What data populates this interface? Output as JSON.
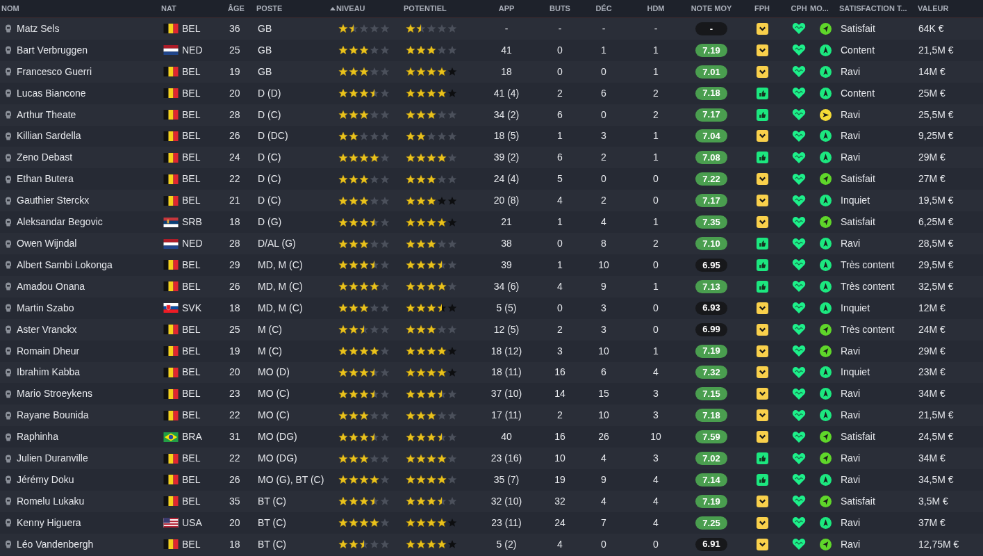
{
  "columns": [
    "NOM",
    "NAT",
    "ÂGE",
    "POSTE",
    "NIVEAU",
    "POTENTIEL",
    "APP",
    "BUTS",
    "DÉC",
    "HDM",
    "NOTE MOY",
    "FPH",
    "CPH",
    "MO...",
    "SATISFACTION T...",
    "VALEUR"
  ],
  "sorted_column": {
    "kind": "ascending"
  },
  "rows": [
    {
      "name": "Matz Sels",
      "nat": "BEL",
      "flag": {
        "kind": "be"
      },
      "age": "36",
      "poste": "GB",
      "niveau": {
        "stars": 1.5
      },
      "potentiel": {
        "stars": 1.5,
        "uncertain": false
      },
      "app": "-",
      "buts": "-",
      "dec": "-",
      "hdm": "-",
      "note": {
        "text": "-",
        "kind": "plain"
      },
      "fph": {
        "kind": "chevron"
      },
      "mo": {
        "kind": "diag"
      },
      "satisfaction": "Satisfait",
      "valeur": "64K €"
    },
    {
      "name": "Bart Verbruggen",
      "nat": "NED",
      "flag": {
        "kind": "nl"
      },
      "age": "25",
      "poste": "GB",
      "niveau": {
        "stars": 3
      },
      "potentiel": {
        "stars": 3,
        "uncertain": false
      },
      "app": "41",
      "buts": "0",
      "dec": "1",
      "hdm": "1",
      "note": {
        "text": "7.19",
        "kind": "good"
      },
      "fph": {
        "kind": "chevron"
      },
      "mo": {
        "kind": "up"
      },
      "satisfaction": "Content",
      "valeur": "21,5M €"
    },
    {
      "name": "Francesco Guerri",
      "nat": "BEL",
      "flag": {
        "kind": "be"
      },
      "age": "19",
      "poste": "GB",
      "niveau": {
        "stars": 3
      },
      "potentiel": {
        "stars": 4,
        "uncertain": true
      },
      "app": "18",
      "buts": "0",
      "dec": "0",
      "hdm": "1",
      "note": {
        "text": "7.01",
        "kind": "good"
      },
      "fph": {
        "kind": "chevron"
      },
      "mo": {
        "kind": "up"
      },
      "satisfaction": "Ravi",
      "valeur": "14M €"
    },
    {
      "name": "Lucas Biancone",
      "nat": "BEL",
      "flag": {
        "kind": "be"
      },
      "age": "20",
      "poste": "D (D)",
      "niveau": {
        "stars": 3.5
      },
      "potentiel": {
        "stars": 4,
        "uncertain": true
      },
      "app": "41 (4)",
      "buts": "2",
      "dec": "6",
      "hdm": "2",
      "note": {
        "text": "7.18",
        "kind": "good"
      },
      "fph": {
        "kind": "thumb"
      },
      "mo": {
        "kind": "up"
      },
      "satisfaction": "Content",
      "valeur": "25M €"
    },
    {
      "name": "Arthur Theate",
      "nat": "BEL",
      "flag": {
        "kind": "be"
      },
      "age": "28",
      "poste": "D (C)",
      "niveau": {
        "stars": 3
      },
      "potentiel": {
        "stars": 3,
        "uncertain": false
      },
      "app": "34 (2)",
      "buts": "6",
      "dec": "0",
      "hdm": "2",
      "note": {
        "text": "7.17",
        "kind": "good"
      },
      "fph": {
        "kind": "thumb"
      },
      "mo": {
        "kind": "right"
      },
      "satisfaction": "Ravi",
      "valeur": "25,5M €"
    },
    {
      "name": "Killian Sardella",
      "nat": "BEL",
      "flag": {
        "kind": "be"
      },
      "age": "26",
      "poste": "D (DC)",
      "niveau": {
        "stars": 2
      },
      "potentiel": {
        "stars": 2,
        "uncertain": false
      },
      "app": "18 (5)",
      "buts": "1",
      "dec": "3",
      "hdm": "1",
      "note": {
        "text": "7.04",
        "kind": "good"
      },
      "fph": {
        "kind": "chevron"
      },
      "mo": {
        "kind": "up"
      },
      "satisfaction": "Ravi",
      "valeur": "9,25M €"
    },
    {
      "name": "Zeno Debast",
      "nat": "BEL",
      "flag": {
        "kind": "be"
      },
      "age": "24",
      "poste": "D (C)",
      "niveau": {
        "stars": 4
      },
      "potentiel": {
        "stars": 4,
        "uncertain": false
      },
      "app": "39 (2)",
      "buts": "6",
      "dec": "2",
      "hdm": "1",
      "note": {
        "text": "7.08",
        "kind": "good"
      },
      "fph": {
        "kind": "thumb"
      },
      "mo": {
        "kind": "up"
      },
      "satisfaction": "Ravi",
      "valeur": "29M €"
    },
    {
      "name": "Ethan Butera",
      "nat": "BEL",
      "flag": {
        "kind": "be"
      },
      "age": "22",
      "poste": "D (C)",
      "niveau": {
        "stars": 3
      },
      "potentiel": {
        "stars": 3,
        "uncertain": false
      },
      "app": "24 (4)",
      "buts": "5",
      "dec": "0",
      "hdm": "0",
      "note": {
        "text": "7.22",
        "kind": "good"
      },
      "fph": {
        "kind": "chevron"
      },
      "mo": {
        "kind": "diag"
      },
      "satisfaction": "Satisfait",
      "valeur": "27M €"
    },
    {
      "name": "Gauthier Sterckx",
      "nat": "BEL",
      "flag": {
        "kind": "be"
      },
      "age": "21",
      "poste": "D (C)",
      "niveau": {
        "stars": 3
      },
      "potentiel": {
        "stars": 3,
        "uncertain": true
      },
      "app": "20 (8)",
      "buts": "4",
      "dec": "2",
      "hdm": "0",
      "note": {
        "text": "7.17",
        "kind": "good"
      },
      "fph": {
        "kind": "chevron"
      },
      "mo": {
        "kind": "up"
      },
      "satisfaction": "Inquiet",
      "valeur": "19,5M €"
    },
    {
      "name": "Aleksandar Begovic",
      "nat": "SRB",
      "flag": {
        "kind": "rs"
      },
      "age": "18",
      "poste": "D (G)",
      "niveau": {
        "stars": 3.5
      },
      "potentiel": {
        "stars": 4,
        "uncertain": true
      },
      "app": "21",
      "buts": "1",
      "dec": "4",
      "hdm": "1",
      "note": {
        "text": "7.35",
        "kind": "good"
      },
      "fph": {
        "kind": "chevron"
      },
      "mo": {
        "kind": "diag"
      },
      "satisfaction": "Satisfait",
      "valeur": "6,25M €"
    },
    {
      "name": "Owen Wijndal",
      "nat": "NED",
      "flag": {
        "kind": "nl"
      },
      "age": "28",
      "poste": "D/AL (G)",
      "niveau": {
        "stars": 3
      },
      "potentiel": {
        "stars": 3,
        "uncertain": false
      },
      "app": "38",
      "buts": "0",
      "dec": "8",
      "hdm": "2",
      "note": {
        "text": "7.10",
        "kind": "good"
      },
      "fph": {
        "kind": "thumb"
      },
      "mo": {
        "kind": "up"
      },
      "satisfaction": "Ravi",
      "valeur": "28,5M €"
    },
    {
      "name": "Albert Sambi Lokonga",
      "nat": "BEL",
      "flag": {
        "kind": "be"
      },
      "age": "29",
      "poste": "MD, M (C)",
      "niveau": {
        "stars": 3.5
      },
      "potentiel": {
        "stars": 3.5,
        "uncertain": false
      },
      "app": "39",
      "buts": "1",
      "dec": "10",
      "hdm": "0",
      "note": {
        "text": "6.95",
        "kind": "plain"
      },
      "fph": {
        "kind": "thumb"
      },
      "mo": {
        "kind": "up"
      },
      "satisfaction": "Très content",
      "valeur": "29,5M €"
    },
    {
      "name": "Amadou Onana",
      "nat": "BEL",
      "flag": {
        "kind": "be"
      },
      "age": "26",
      "poste": "MD, M (C)",
      "niveau": {
        "stars": 4
      },
      "potentiel": {
        "stars": 4,
        "uncertain": false
      },
      "app": "34 (6)",
      "buts": "4",
      "dec": "9",
      "hdm": "1",
      "note": {
        "text": "7.13",
        "kind": "good"
      },
      "fph": {
        "kind": "thumb"
      },
      "mo": {
        "kind": "up"
      },
      "satisfaction": "Très content",
      "valeur": "32,5M €"
    },
    {
      "name": "Martin Szabo",
      "nat": "SVK",
      "flag": {
        "kind": "sk"
      },
      "age": "18",
      "poste": "MD, M (C)",
      "niveau": {
        "stars": 3
      },
      "potentiel": {
        "stars": 3.5,
        "uncertain": true
      },
      "app": "5 (5)",
      "buts": "0",
      "dec": "3",
      "hdm": "0",
      "note": {
        "text": "6.93",
        "kind": "plain"
      },
      "fph": {
        "kind": "chevron"
      },
      "mo": {
        "kind": "up"
      },
      "satisfaction": "Inquiet",
      "valeur": "12M €"
    },
    {
      "name": "Aster Vranckx",
      "nat": "BEL",
      "flag": {
        "kind": "be"
      },
      "age": "25",
      "poste": "M (C)",
      "niveau": {
        "stars": 2.5
      },
      "potentiel": {
        "stars": 3,
        "uncertain": false
      },
      "app": "12 (5)",
      "buts": "2",
      "dec": "3",
      "hdm": "0",
      "note": {
        "text": "6.99",
        "kind": "plain"
      },
      "fph": {
        "kind": "chevron"
      },
      "mo": {
        "kind": "diag"
      },
      "satisfaction": "Très content",
      "valeur": "24M €"
    },
    {
      "name": "Romain Dheur",
      "nat": "BEL",
      "flag": {
        "kind": "be"
      },
      "age": "19",
      "poste": "M (C)",
      "niveau": {
        "stars": 4
      },
      "potentiel": {
        "stars": 4,
        "uncertain": true
      },
      "app": "18 (12)",
      "buts": "3",
      "dec": "10",
      "hdm": "1",
      "note": {
        "text": "7.19",
        "kind": "good"
      },
      "fph": {
        "kind": "chevron"
      },
      "mo": {
        "kind": "diag"
      },
      "satisfaction": "Ravi",
      "valeur": "29M €"
    },
    {
      "name": "Ibrahim Kabba",
      "nat": "BEL",
      "flag": {
        "kind": "be"
      },
      "age": "20",
      "poste": "MO (D)",
      "niveau": {
        "stars": 3.5
      },
      "potentiel": {
        "stars": 4,
        "uncertain": true
      },
      "app": "18 (11)",
      "buts": "16",
      "dec": "6",
      "hdm": "4",
      "note": {
        "text": "7.32",
        "kind": "good"
      },
      "fph": {
        "kind": "chevron"
      },
      "mo": {
        "kind": "up"
      },
      "satisfaction": "Inquiet",
      "valeur": "23M €"
    },
    {
      "name": "Mario Stroeykens",
      "nat": "BEL",
      "flag": {
        "kind": "be"
      },
      "age": "23",
      "poste": "MO (C)",
      "niveau": {
        "stars": 3.5
      },
      "potentiel": {
        "stars": 3.5,
        "uncertain": false
      },
      "app": "37 (10)",
      "buts": "14",
      "dec": "15",
      "hdm": "3",
      "note": {
        "text": "7.15",
        "kind": "good"
      },
      "fph": {
        "kind": "chevron"
      },
      "mo": {
        "kind": "up"
      },
      "satisfaction": "Ravi",
      "valeur": "34M €"
    },
    {
      "name": "Rayane Bounida",
      "nat": "BEL",
      "flag": {
        "kind": "be"
      },
      "age": "22",
      "poste": "MO (C)",
      "niveau": {
        "stars": 3
      },
      "potentiel": {
        "stars": 3,
        "uncertain": false
      },
      "app": "17 (11)",
      "buts": "2",
      "dec": "10",
      "hdm": "3",
      "note": {
        "text": "7.18",
        "kind": "good"
      },
      "fph": {
        "kind": "chevron"
      },
      "mo": {
        "kind": "up"
      },
      "satisfaction": "Ravi",
      "valeur": "21,5M €"
    },
    {
      "name": "Raphinha",
      "nat": "BRA",
      "flag": {
        "kind": "br"
      },
      "age": "31",
      "poste": "MO (DG)",
      "niveau": {
        "stars": 3.5
      },
      "potentiel": {
        "stars": 3.5,
        "uncertain": false
      },
      "app": "40",
      "buts": "16",
      "dec": "26",
      "hdm": "10",
      "note": {
        "text": "7.59",
        "kind": "good"
      },
      "fph": {
        "kind": "chevron"
      },
      "mo": {
        "kind": "diag"
      },
      "satisfaction": "Satisfait",
      "valeur": "24,5M €"
    },
    {
      "name": "Julien Duranville",
      "nat": "BEL",
      "flag": {
        "kind": "be"
      },
      "age": "22",
      "poste": "MO (DG)",
      "niveau": {
        "stars": 3
      },
      "potentiel": {
        "stars": 4,
        "uncertain": false
      },
      "app": "23 (16)",
      "buts": "10",
      "dec": "4",
      "hdm": "3",
      "note": {
        "text": "7.02",
        "kind": "good"
      },
      "fph": {
        "kind": "thumb"
      },
      "mo": {
        "kind": "diag"
      },
      "satisfaction": "Ravi",
      "valeur": "34M €"
    },
    {
      "name": "Jérémy Doku",
      "nat": "BEL",
      "flag": {
        "kind": "be"
      },
      "age": "26",
      "poste": "MO (G), BT (C)",
      "niveau": {
        "stars": 4
      },
      "potentiel": {
        "stars": 4,
        "uncertain": false
      },
      "app": "35 (7)",
      "buts": "19",
      "dec": "9",
      "hdm": "4",
      "note": {
        "text": "7.14",
        "kind": "good"
      },
      "fph": {
        "kind": "thumb"
      },
      "mo": {
        "kind": "up"
      },
      "satisfaction": "Ravi",
      "valeur": "34,5M €"
    },
    {
      "name": "Romelu Lukaku",
      "nat": "BEL",
      "flag": {
        "kind": "be"
      },
      "age": "35",
      "poste": "BT (C)",
      "niveau": {
        "stars": 3.5
      },
      "potentiel": {
        "stars": 3.5,
        "uncertain": false
      },
      "app": "32 (10)",
      "buts": "32",
      "dec": "4",
      "hdm": "4",
      "note": {
        "text": "7.19",
        "kind": "good"
      },
      "fph": {
        "kind": "chevron"
      },
      "mo": {
        "kind": "diag"
      },
      "satisfaction": "Satisfait",
      "valeur": "3,5M €"
    },
    {
      "name": "Kenny Higuera",
      "nat": "USA",
      "flag": {
        "kind": "us"
      },
      "age": "20",
      "poste": "BT (C)",
      "niveau": {
        "stars": 4
      },
      "potentiel": {
        "stars": 4,
        "uncertain": true
      },
      "app": "23 (11)",
      "buts": "24",
      "dec": "7",
      "hdm": "4",
      "note": {
        "text": "7.25",
        "kind": "good"
      },
      "fph": {
        "kind": "chevron"
      },
      "mo": {
        "kind": "up"
      },
      "satisfaction": "Ravi",
      "valeur": "37M €"
    },
    {
      "name": "Léo Vandenbergh",
      "nat": "BEL",
      "flag": {
        "kind": "be"
      },
      "age": "18",
      "poste": "BT (C)",
      "niveau": {
        "stars": 2.5
      },
      "potentiel": {
        "stars": 4,
        "uncertain": true
      },
      "app": "5 (2)",
      "buts": "4",
      "dec": "0",
      "hdm": "0",
      "note": {
        "text": "6.91",
        "kind": "plain"
      },
      "fph": {
        "kind": "chevron"
      },
      "mo": {
        "kind": "diag"
      },
      "satisfaction": "Ravi",
      "valeur": "12,75M €"
    }
  ]
}
